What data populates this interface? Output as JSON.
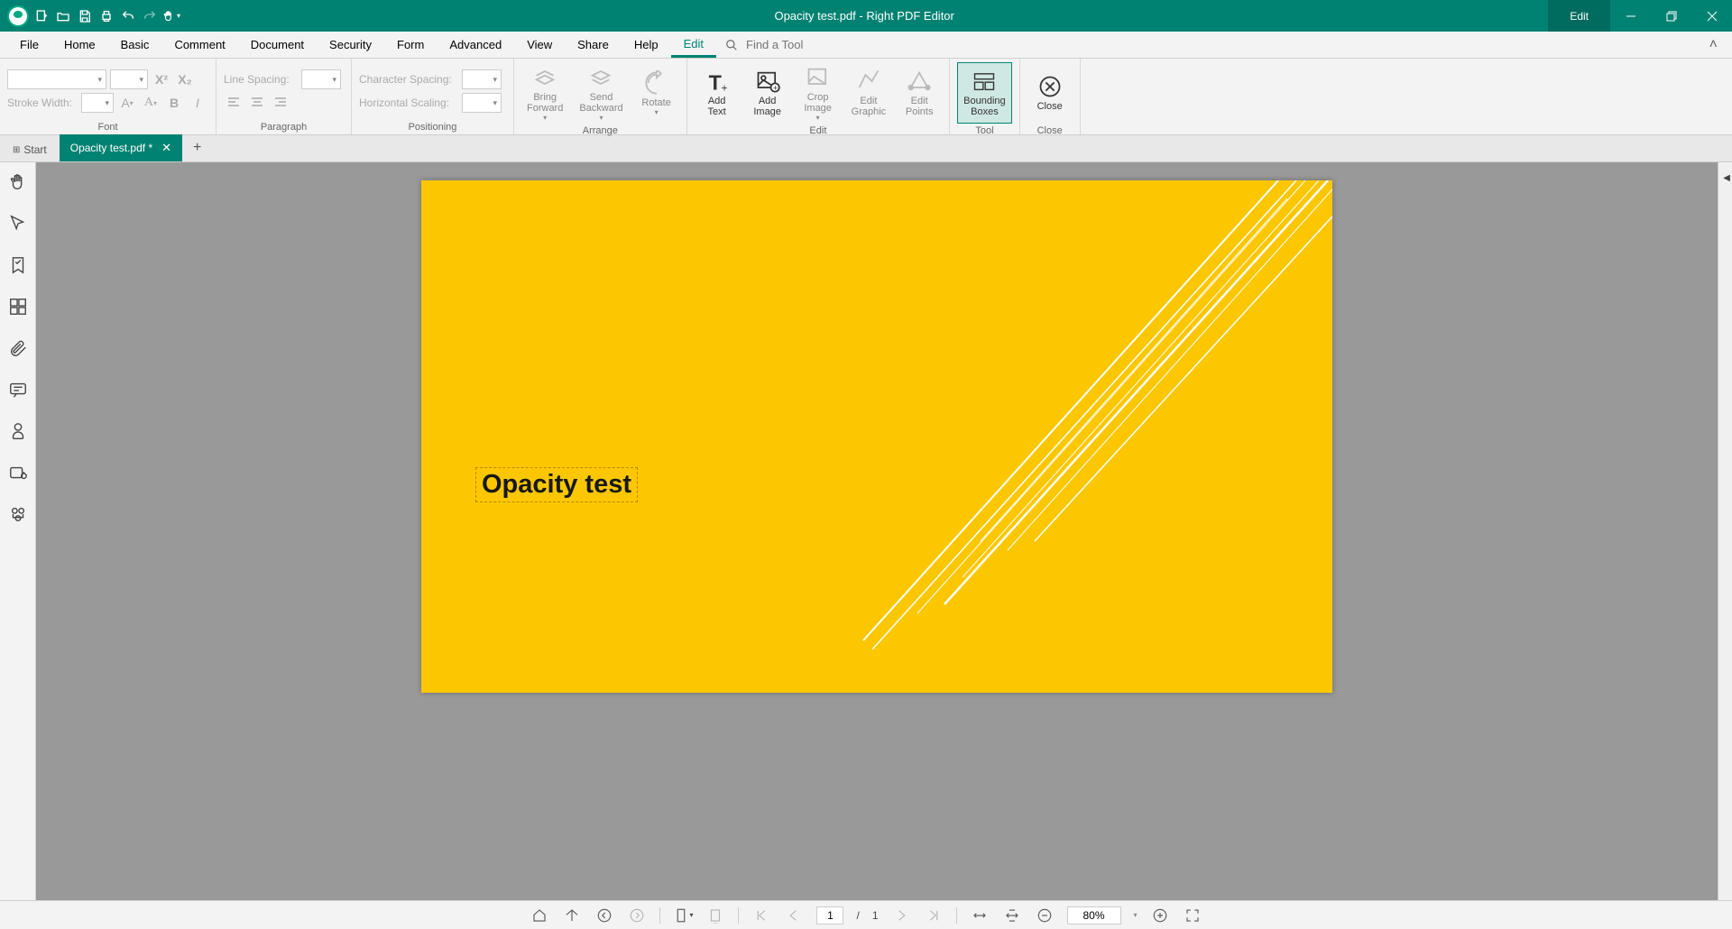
{
  "titlebar": {
    "title": "Opacity test.pdf - Right PDF Editor",
    "mode": "Edit"
  },
  "menu": {
    "items": [
      "File",
      "Home",
      "Basic",
      "Comment",
      "Document",
      "Security",
      "Form",
      "Advanced",
      "View",
      "Share",
      "Help",
      "Edit"
    ],
    "active_index": 11,
    "search_placeholder": "Find a Tool"
  },
  "ribbon": {
    "font": {
      "label": "Font",
      "stroke_width_label": "Stroke Width:"
    },
    "paragraph": {
      "label": "Paragraph",
      "line_spacing_label": "Line Spacing:"
    },
    "positioning": {
      "label": "Positioning",
      "char_spacing_label": "Character Spacing:",
      "horiz_scaling_label": "Horizontal Scaling:"
    },
    "arrange": {
      "label": "Arrange",
      "bring_forward": "Bring\nForward",
      "send_backward": "Send\nBackward",
      "rotate": "Rotate"
    },
    "edit": {
      "label": "Edit",
      "add_text": "Add\nText",
      "add_image": "Add\nImage",
      "crop_image": "Crop\nImage",
      "edit_graphic": "Edit\nGraphic",
      "edit_points": "Edit\nPoints"
    },
    "tool": {
      "label": "Tool",
      "bounding_boxes": "Bounding\nBoxes"
    },
    "close": {
      "label": "Close",
      "close_btn": "Close"
    }
  },
  "tabs": {
    "start": "Start",
    "doc_name": "Opacity test.pdf *"
  },
  "page": {
    "text": "Opacity test"
  },
  "status": {
    "current_page": "1",
    "total_pages": "1",
    "page_sep": "/",
    "zoom": "80%"
  }
}
